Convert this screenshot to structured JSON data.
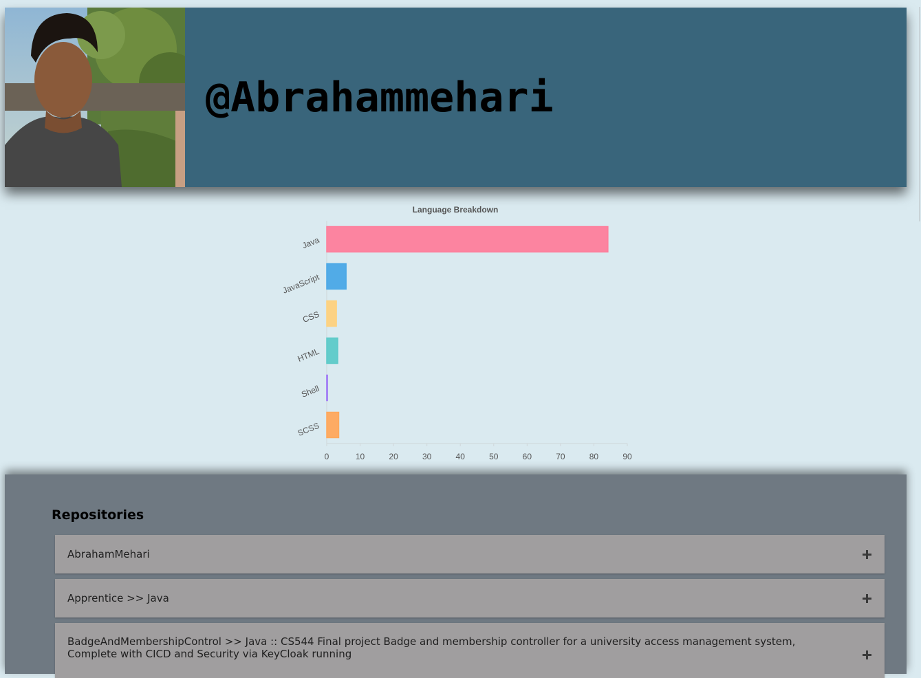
{
  "profile": {
    "username": "@Abrahammehari",
    "avatar_alt": "profile photo"
  },
  "chart_data": {
    "type": "bar",
    "orientation": "horizontal",
    "title": "Language Breakdown",
    "categories": [
      "Java",
      "JavaScript",
      "CSS",
      "HTML",
      "Shell",
      "SCSS"
    ],
    "values": [
      84.2,
      5.8,
      2.9,
      3.3,
      0.1,
      3.6
    ],
    "colors": [
      "#fe7e9b",
      "#4aa8e6",
      "#fed17d",
      "#5dcac8",
      "#9a6ff6",
      "#ffa85b"
    ],
    "xlim": [
      0,
      90
    ],
    "xticks": [
      "0",
      "10",
      "20",
      "30",
      "40",
      "50",
      "60",
      "70",
      "80",
      "90"
    ],
    "legend": "none",
    "grid": false
  },
  "repositories": {
    "title": "Repositories",
    "items": [
      {
        "label": "AbrahamMehari"
      },
      {
        "label": "Apprentice >> Java"
      },
      {
        "label": "BadgeAndMembershipControl >> Java :: CS544 Final project Badge and membership controller for a university access management system, Complete with CICD and Security via KeyCloak running"
      }
    ]
  }
}
